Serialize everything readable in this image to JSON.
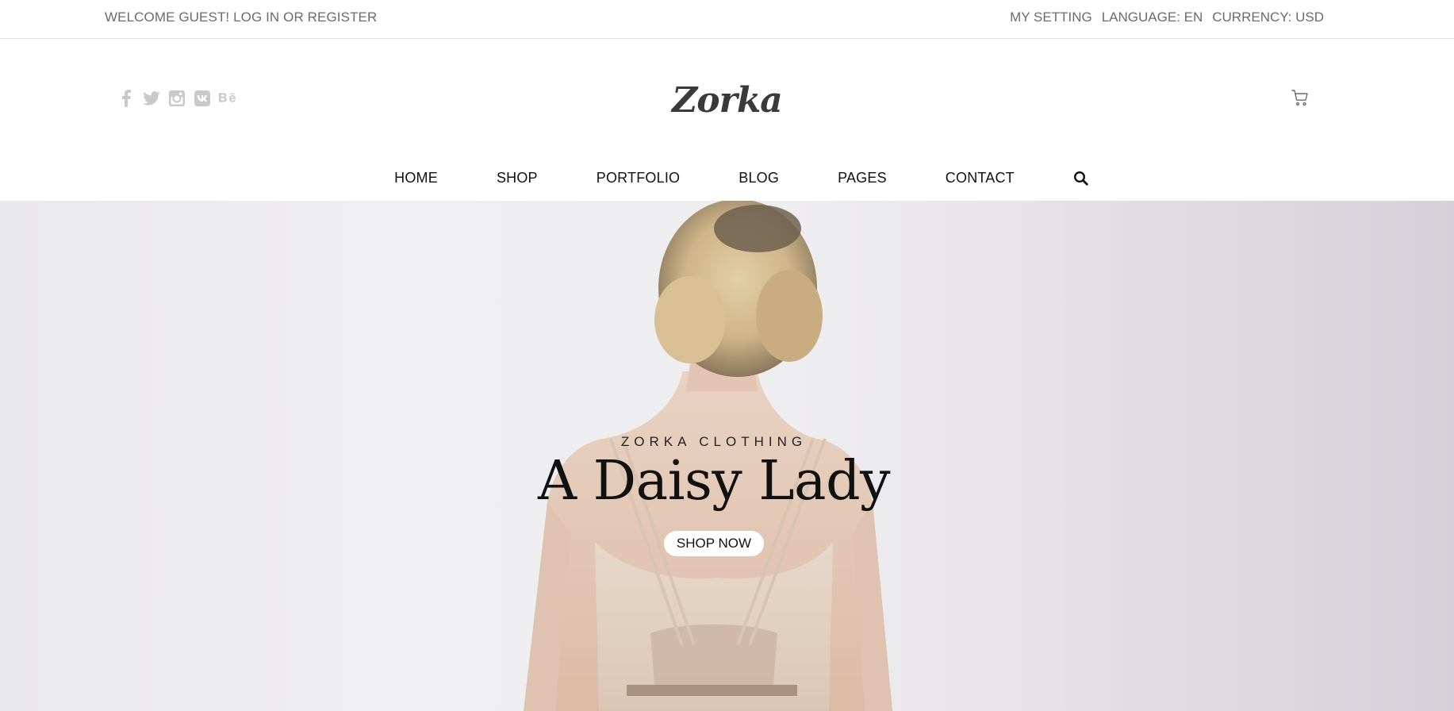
{
  "topbar": {
    "welcome": "WELCOME GUEST!",
    "login": "LOG IN",
    "or": "OR",
    "register": "REGISTER",
    "my_setting": "MY SETTING",
    "language": "LANGUAGE: EN",
    "currency": "CURRENCY: USD"
  },
  "header": {
    "logo": "Zorka",
    "social_icons": [
      "facebook-icon",
      "twitter-icon",
      "instagram-icon",
      "vk-icon",
      "behance-icon"
    ],
    "cart_icon": "cart-icon"
  },
  "nav": {
    "items": [
      "HOME",
      "SHOP",
      "PORTFOLIO",
      "BLOG",
      "PAGES",
      "CONTACT"
    ],
    "search_icon": "search-icon"
  },
  "hero": {
    "kicker": "ZORKA CLOTHING",
    "headline": "A Daisy Lady",
    "cta": "SHOP NOW"
  },
  "colors": {
    "topbar_text": "#6b6b6b",
    "social_icon": "#c9c9c9",
    "logo": "#3a3a3a",
    "hero_bg": "#eeedf0"
  }
}
